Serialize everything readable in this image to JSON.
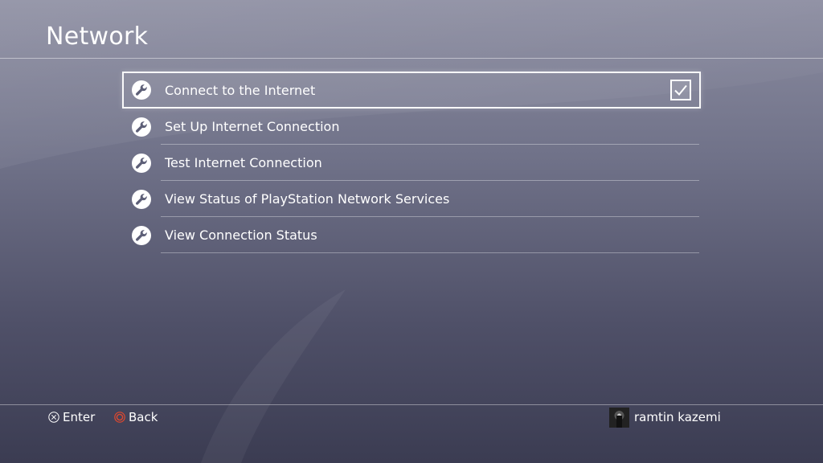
{
  "header": {
    "title": "Network"
  },
  "menu": {
    "items": [
      {
        "label": "Connect to the Internet",
        "icon": "wrench-icon",
        "selected": true,
        "checked": true
      },
      {
        "label": "Set Up Internet Connection",
        "icon": "wrench-icon",
        "selected": false
      },
      {
        "label": "Test Internet Connection",
        "icon": "wrench-icon",
        "selected": false
      },
      {
        "label": "View Status of PlayStation Network Services",
        "icon": "wrench-icon",
        "selected": false
      },
      {
        "label": "View Connection Status",
        "icon": "wrench-icon",
        "selected": false
      }
    ]
  },
  "footer": {
    "enter_label": "Enter",
    "enter_icon": "cross-button-icon",
    "back_label": "Back",
    "back_icon": "circle-button-icon",
    "user_name": "ramtin kazemi"
  },
  "colors": {
    "background_top": "#8c8da1",
    "background_bottom": "#3b3c52",
    "circle_button": "#e0482e",
    "text": "#ffffff"
  }
}
